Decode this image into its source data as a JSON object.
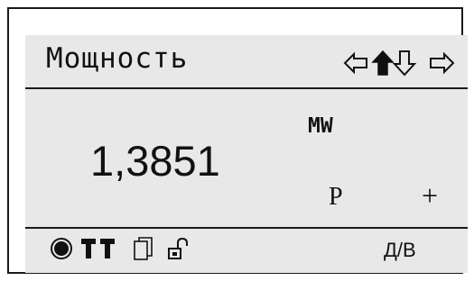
{
  "display": {
    "title": "Мощность",
    "unit": "MW",
    "value": "1,3851",
    "quantity_letter": "P",
    "sign": "+",
    "mode": "Д/В"
  },
  "nav_icons": [
    "arrow-left-icon",
    "arrow-up-filled-icon",
    "arrow-down-icon",
    "arrow-right-icon"
  ],
  "status_icons": [
    "record-dot-icon",
    "double-t-icon",
    "pages-icon",
    "unlocked-padlock-icon"
  ],
  "colors": {
    "screen": "#e8e8e8",
    "ink": "#111111",
    "frame": "#1a1a1a"
  }
}
